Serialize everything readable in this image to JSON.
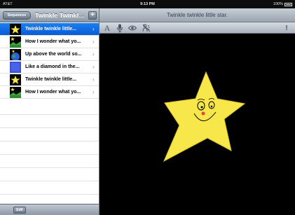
{
  "status_bar": {
    "carrier": "AT&T",
    "time": "9:13 PM",
    "battery": "100%"
  },
  "sidebar": {
    "back_label": "Sequences",
    "title": "Twinkle Twinkle...",
    "add_label": "+",
    "items": [
      {
        "label": "Twinkle twinkle little...",
        "thumb": "star",
        "selected": true
      },
      {
        "label": "How I wonder what yo...",
        "thumb": "landscape",
        "selected": false
      },
      {
        "label": "Up above the world so...",
        "thumb": "world",
        "selected": false
      },
      {
        "label": "Like a diamond in the...",
        "thumb": "diamond",
        "selected": false
      },
      {
        "label": "Twinkle twinkle little...",
        "thumb": "star",
        "selected": false
      },
      {
        "label": "How I wonder what yo...",
        "thumb": "landscape",
        "selected": false
      }
    ],
    "edit_label": "Edit"
  },
  "detail": {
    "title": "Twinkle twinkle little star.",
    "toolbar": {
      "text_tool": "A",
      "record_icon": "microphone-icon",
      "view_icon": "eye-icon",
      "mute_icon": "no-speak-icon",
      "alert_label": "!"
    },
    "canvas": {
      "subject": "smiling-star",
      "star_color": "#f7e74a",
      "background": "#000000"
    }
  },
  "colors": {
    "selection": "#0a64e0",
    "nav_bar": "#9aa4b0"
  }
}
